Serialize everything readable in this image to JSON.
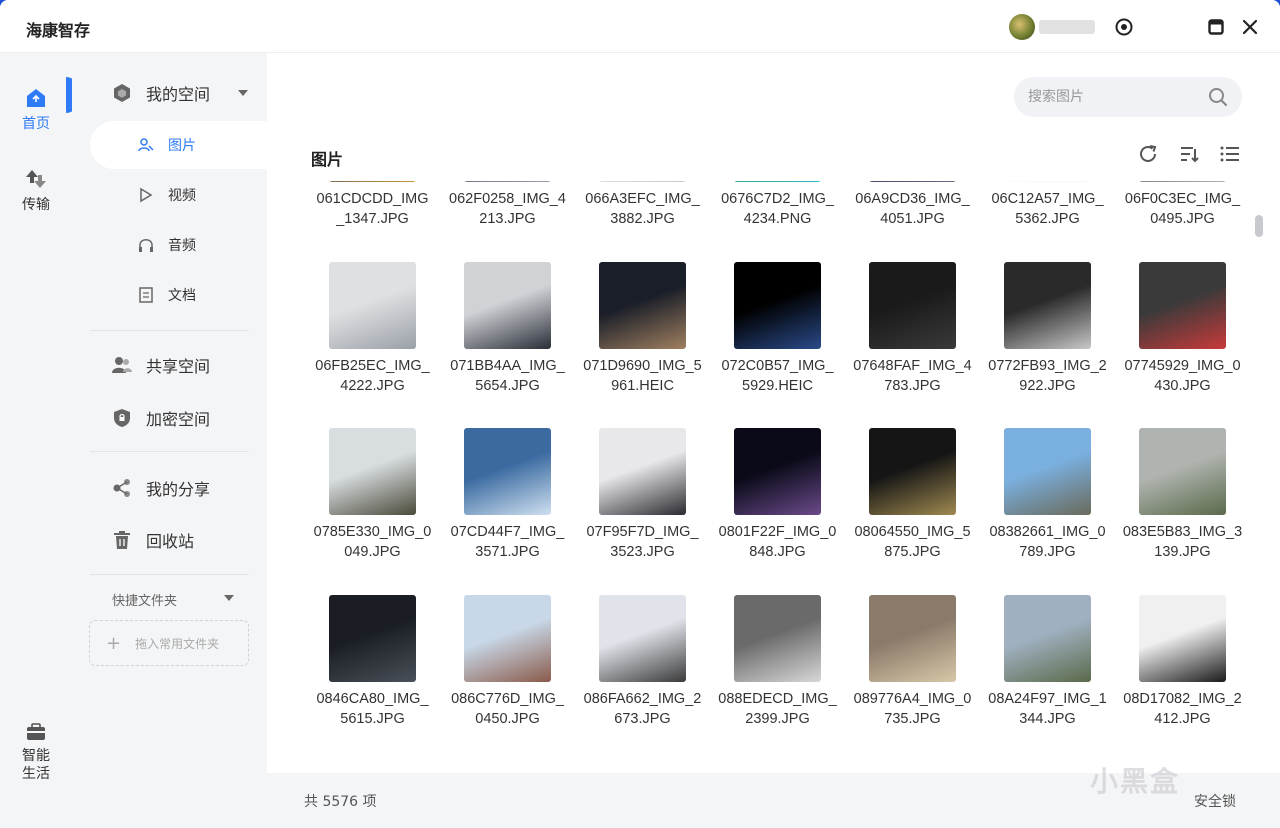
{
  "app": {
    "title": "海康智存"
  },
  "titlebar": {
    "settings_icon": "target-icon",
    "maximize_icon": "maximize-icon",
    "close_icon": "close-icon",
    "minimize_icon": "minimize-icon"
  },
  "rail": {
    "items": [
      {
        "label": "首页",
        "icon": "home-icon",
        "active": true
      },
      {
        "label": "传输",
        "icon": "transfer-icon",
        "active": false
      },
      {
        "label": "智能生活",
        "icon": "briefcase-icon",
        "active": false
      }
    ]
  },
  "nav": {
    "my_space": "我的空间",
    "subs": [
      {
        "label": "图片",
        "icon": "person-photo-icon"
      },
      {
        "label": "视频",
        "icon": "play-icon"
      },
      {
        "label": "音频",
        "icon": "headphones-icon"
      },
      {
        "label": "文档",
        "icon": "document-icon"
      }
    ],
    "shared_space": "共享空间",
    "encrypted_space": "加密空间",
    "my_share": "我的分享",
    "recycle": "回收站",
    "quick_folder": "快捷文件夹",
    "drag_hint": "拖入常用文件夹"
  },
  "main": {
    "search_placeholder": "搜索图片",
    "title": "图片",
    "count": "共 5576 项",
    "safe_lock": "安全锁",
    "watermark": "小黑盒"
  },
  "files": [
    {
      "name": "061CDCDD_IMG_1347.JPG",
      "colors": [
        "#3a3a6a",
        "#c89a3a"
      ]
    },
    {
      "name": "062F0258_IMG_4213.JPG",
      "colors": [
        "#4a5060",
        "#9aa0b0"
      ]
    },
    {
      "name": "066A3EFC_IMG_3882.JPG",
      "colors": [
        "#f2f2f2",
        "#c8c8c8"
      ]
    },
    {
      "name": "0676C7D2_IMG_4234.PNG",
      "colors": [
        "#2a8a4a",
        "#2fc0d0"
      ]
    },
    {
      "name": "06A9CD36_IMG_4051.JPG",
      "colors": [
        "#2a2a3a",
        "#6a6a8a"
      ]
    },
    {
      "name": "06C12A57_IMG_5362.JPG",
      "colors": [
        "#ffffff",
        "#f6f6f6"
      ]
    },
    {
      "name": "06F0C3EC_IMG_0495.JPG",
      "colors": [
        "#5a5a5a",
        "#b0b0b0"
      ]
    },
    {
      "name": "06FB25EC_IMG_4222.JPG",
      "colors": [
        "#dfe0e2",
        "#9aa0a8"
      ]
    },
    {
      "name": "071BB4AA_IMG_5654.JPG",
      "colors": [
        "#d0d2d6",
        "#2a2e38"
      ]
    },
    {
      "name": "071D9690_IMG_5961.HEIC",
      "colors": [
        "#1a1e28",
        "#a08060"
      ]
    },
    {
      "name": "072C0B57_IMG_5929.HEIC",
      "colors": [
        "#000000",
        "#2a4a8a"
      ]
    },
    {
      "name": "07648FAF_IMG_4783.JPG",
      "colors": [
        "#1a1a1a",
        "#3a3a3a"
      ]
    },
    {
      "name": "0772FB93_IMG_2922.JPG",
      "colors": [
        "#2a2a2a",
        "#c8c8c8"
      ]
    },
    {
      "name": "07745929_IMG_0430.JPG",
      "colors": [
        "#3a3a3a",
        "#c83a3a"
      ]
    },
    {
      "name": "0785E330_IMG_0049.JPG",
      "colors": [
        "#d8dde0",
        "#4a4a3a"
      ]
    },
    {
      "name": "07CD44F7_IMG_3571.JPG",
      "colors": [
        "#3a6aa0",
        "#cfe0f0"
      ]
    },
    {
      "name": "07F95F7D_IMG_3523.JPG",
      "colors": [
        "#e8e8ea",
        "#2a2a30"
      ]
    },
    {
      "name": "0801F22F_IMG_0848.JPG",
      "colors": [
        "#0a0a18",
        "#6a4a8a"
      ]
    },
    {
      "name": "08064550_IMG_5875.JPG",
      "colors": [
        "#151515",
        "#a08a50"
      ]
    },
    {
      "name": "08382661_IMG_0789.JPG",
      "colors": [
        "#7ab0e0",
        "#6a6a5a"
      ]
    },
    {
      "name": "083E5B83_IMG_3139.JPG",
      "colors": [
        "#b0b4b0",
        "#5a6a4a"
      ]
    },
    {
      "name": "0846CA80_IMG_5615.JPG",
      "colors": [
        "#1a1e24",
        "#4a5058"
      ]
    },
    {
      "name": "086C776D_IMG_0450.JPG",
      "colors": [
        "#c8d8e8",
        "#8a5a4a"
      ]
    },
    {
      "name": "086FA662_IMG_2673.JPG",
      "colors": [
        "#e0e4ea",
        "#3a3a3a"
      ]
    },
    {
      "name": "088EDECD_IMG_2399.JPG",
      "colors": [
        "#6a6a6a",
        "#d8d8d8"
      ]
    },
    {
      "name": "089776A4_IMG_0735.JPG",
      "colors": [
        "#8a7a6a",
        "#d8c8a8"
      ]
    },
    {
      "name": "08A24F97_IMG_1344.JPG",
      "colors": [
        "#a0b0c0",
        "#5a6a4a"
      ]
    },
    {
      "name": "08D17082_IMG_2412.JPG",
      "colors": [
        "#f0f0f0",
        "#1a1a1a"
      ]
    }
  ]
}
